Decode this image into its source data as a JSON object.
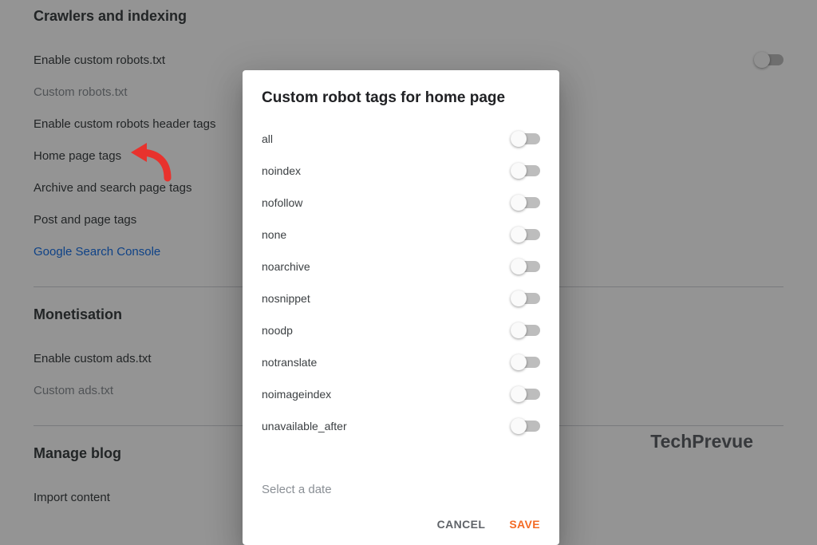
{
  "crawlers": {
    "title": "Crawlers and indexing",
    "enable_robots_txt": "Enable custom robots.txt",
    "custom_robots_txt": "Custom robots.txt",
    "enable_header_tags": "Enable custom robots header tags",
    "home_page_tags": "Home page tags",
    "archive_search_tags": "Archive and search page tags",
    "post_page_tags": "Post and page tags",
    "search_console": "Google Search Console"
  },
  "monetisation": {
    "title": "Monetisation",
    "enable_ads_txt": "Enable custom ads.txt",
    "custom_ads_txt": "Custom ads.txt"
  },
  "manage": {
    "title": "Manage blog",
    "import_content": "Import content"
  },
  "dialog": {
    "title": "Custom robot tags for home page",
    "options": [
      "all",
      "noindex",
      "nofollow",
      "none",
      "noarchive",
      "nosnippet",
      "noodp",
      "notranslate",
      "noimageindex",
      "unavailable_after"
    ],
    "select_date": "Select a date",
    "cancel": "CANCEL",
    "save": "SAVE"
  },
  "watermark": "TechPrevue"
}
